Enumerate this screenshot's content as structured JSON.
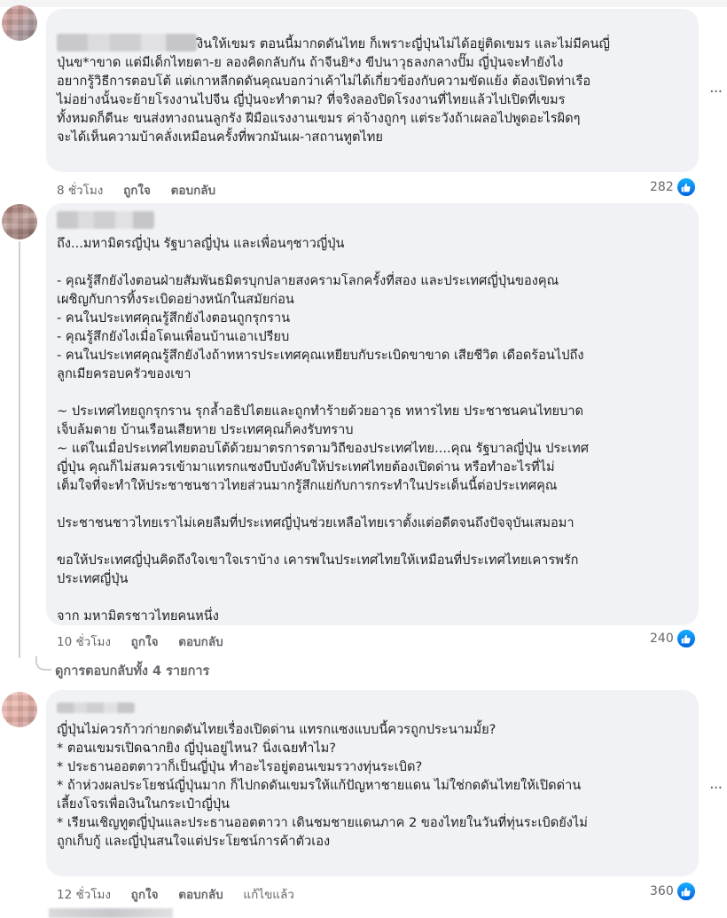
{
  "comments": [
    {
      "text": "งินให้เขมร ตอนนี้มากดดันไทย ก็เพราะญี่ปุ่นไม่ได้อยู่ติดเขมร และไม่มีคนญี่\nปุ่นข*าขาด แต่มีเด็กไทยตา-ย ลองคิดกลับกัน ถ้าจีนยิ*ง ขีปนาวุธลงกลางปั๊ม ญี่ปุ่นจะทำยังไง\nอยากรู้วิธีการตอบโต้ แต่เกาหลีกดดันคุณบอกว่าเค้าไม่ได้เกี่ยวข้องกับความขัดแย้ง ต้องเปิดท่าเรือ\nไม่อย่างนั้นจะย้ายโรงงานไปจีน ญี่ปุ่นจะทำตาม? ที่จริงลองปิดโรงงานที่ไทยแล้วไปเปิดที่เขมร\nทั้งหมดก็ดีนะ ขนส่งทางถนนลูกรัง ฝีมือแรงงานเขมร ค่าจ้างถูกๆ แต่ระวังถ้าเผลอไปพูดอะไรผิดๆ\nจะได้เห็นความบ้าคลั่งเหมือนครั้งที่พวกมันเผ-าสถานทูตไทย",
      "time": "8 ชั่วโมง",
      "like": "ถูกใจ",
      "reply": "ตอบกลับ",
      "edited": "",
      "reactions": "282"
    },
    {
      "text": "ถึง...มหามิตรญี่ปุ่น รัฐบาลญี่ปุ่น และเพื่อนๆชาวญี่ปุ่น\n\n- คุณรู้สึกยังไงตอนฝ่ายสัมพันธมิตรบุกปลายสงครามโลกครั้งที่สอง และประเทศญี่ปุ่นของคุณ\nเผชิญกับการทิ้งระเบิดอย่างหนักในสมัยก่อน\n- คนในประเทศคุณรู้สึกยังไงตอนถูกรุกราน\n- คุณรู้สึกยังไงเมื่อโดนเพื่อนบ้านเอาเปรียบ\n- คนในประเทศคุณรู้สึกยังไงถ้าทหารประเทศคุณเหยียบกับระเบิดขาขาด เสียชีวิต เดือดร้อนไปถึง\nลูกเมียครอบครัวของเขา\n\n~ ประเทศไทยถูกรุกราน รุกล้ำอธิปไตยและถูกทำร้ายด้วยอาวุธ ทหารไทย ประชาชนคนไทยบาด\nเจ็บล้มตาย บ้านเรือนเสียหาย ประเทศคุณก็คงรับทราบ\n~ แต่ในเมื่อประเทศไทยตอบโต้ด้วยมาตรการตามวิถีของประเทศไทย....คุณ รัฐบาลญี่ปุ่น ประเทศ\nญี่ปุ่น คุณก็ไม่สมควรเข้ามาแทรกแซงบีบบังคับให้ประเทศไทยต้องเปิดด่าน หรือทำอะไรที่ไม่\nเต็มใจที่จะทำให้ประชาชนชาวไทยส่วนมากรู้สึกแย่กับการกระทำในประเด็นนี้ต่อประเทศคุณ\n\nประชาชนชาวไทยเราไม่เคยลืมที่ประเทศญี่ปุ่นช่วยเหลือไทยเราตั้งแต่อดีตจนถึงปัจจุบันเสมอมา\n\nขอให้ประเทศญี่ปุ่นคิดถึงใจเขาใจเราบ้าง เคารพในประเทศไทยให้เหมือนที่ประเทศไทยเคารพรัก\nประเทศญี่ปุ่น\n\nจาก มหามิตรชาวไทยคนหนึ่ง",
      "time": "10 ชั่วโมง",
      "like": "ถูกใจ",
      "reply": "ตอบกลับ",
      "edited": "",
      "reactions": "240"
    },
    {
      "text": "ญี่ปุ่นไม่ควรก้าวก่ายกดดันไทยเรื่องเปิดด่าน แทรกแซงแบบนี้ควรถูกประนามมั้ย?\n* ตอนเขมรเปิดฉากยิง ญี่ปุ่นอยู่ไหน? นิ่งเฉยทำไม?\n* ประธานออตตาวาก็เป็นญี่ปุ่น ทำอะไรอยู่ตอนเขมรวางทุ่นระเบิด?\n* ถ้าห่วงผลประโยชน์ญี่ปุ่นมาก ก็ไปกดดันเขมรให้แก้ปัญหาชายแดน ไม่ใช่กดดันไทยให้เปิดด่าน\nเลี้ยงโจรเพื่อเงินในกระเป๋าญี่ปุ่น\n* เรียนเชิญทูตญี่ปุ่นและประธานออตตาวา เดินชมชายแดนภาค 2 ของไทยในวันที่ทุ่นระเบิดยังไม่\nถูกเก็บกู้ และญี่ปุ่นสนใจแต่ประโยชน์การค้าตัวเอง",
      "time": "12 ชั่วโมง",
      "like": "ถูกใจ",
      "reply": "ตอบกลับ",
      "edited": "แก้ไขแล้ว",
      "reactions": "360"
    }
  ],
  "view_replies": "ดูการตอบกลับทั้ง 4 รายการ",
  "more_icon": "···",
  "colors": {
    "bubble": "#f0f2f5",
    "meta": "#65676b",
    "like_blue": "#0866ff"
  }
}
